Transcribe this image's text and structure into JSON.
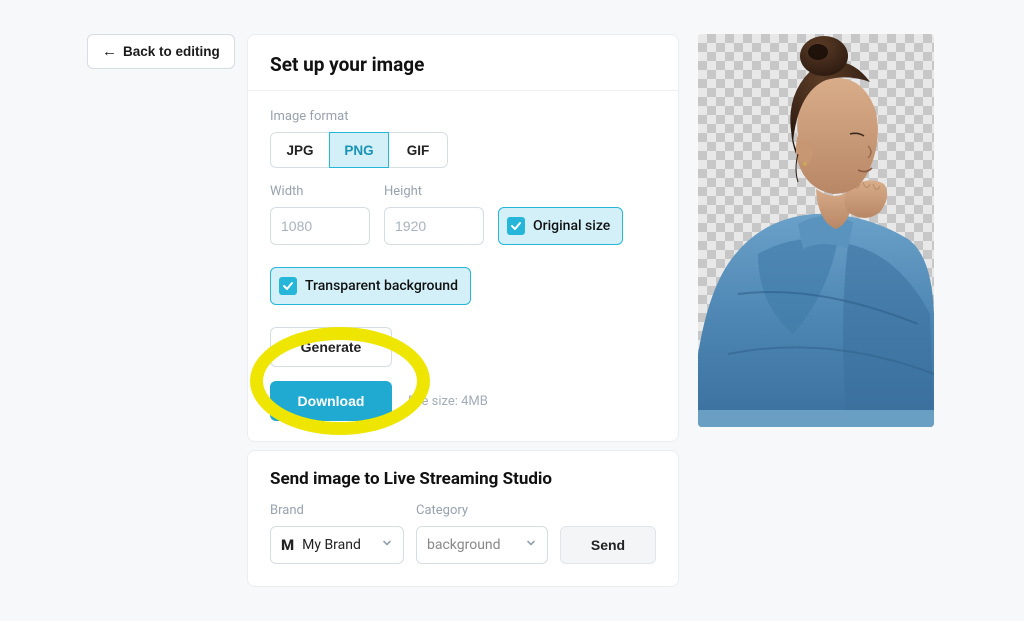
{
  "back": {
    "label": "Back to editing"
  },
  "setup": {
    "title": "Set up your image",
    "format_label": "Image format",
    "formats": [
      "JPG",
      "PNG",
      "GIF"
    ],
    "active_format": "PNG",
    "width_label": "Width",
    "width_value": "1080",
    "height_label": "Height",
    "height_value": "1920",
    "original_size_label": "Original size",
    "original_size_checked": true,
    "transparent_label": "Transparent background",
    "transparent_checked": true,
    "generate_label": "Generate",
    "download_label": "Download",
    "file_size_text": "File size: 4MB"
  },
  "send": {
    "title": "Send image to Live Streaming Studio",
    "brand_label": "Brand",
    "brand_value": "My Brand",
    "brand_logo": "M",
    "category_label": "Category",
    "category_value": "background",
    "send_label": "Send"
  },
  "colors": {
    "accent": "#21aad1",
    "highlight": "#eee600"
  }
}
